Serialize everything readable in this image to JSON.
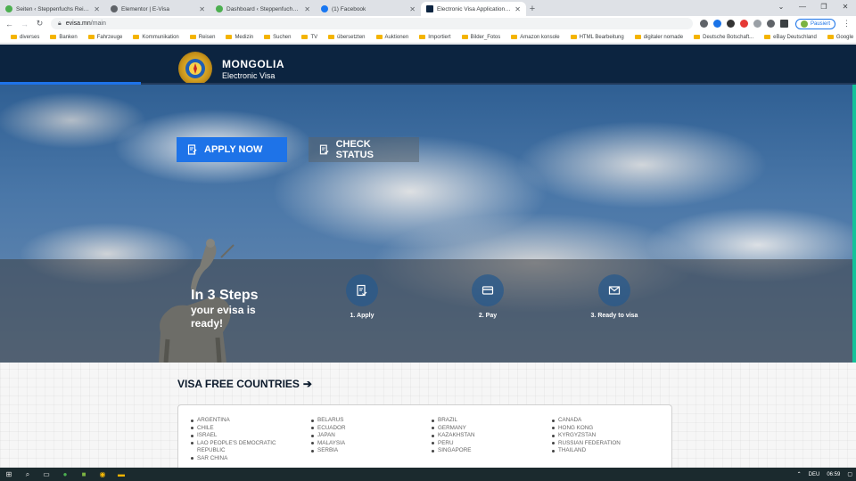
{
  "browser": {
    "tabs": [
      {
        "title": "Seiten ‹ Steppenfuchs Reisen —",
        "color": "#4caf50",
        "active": false
      },
      {
        "title": "Elementor | E-Visa",
        "color": "#5f6368",
        "active": false
      },
      {
        "title": "Dashboard ‹ Steppenfuchs Reise",
        "color": "#4caf50",
        "active": false
      },
      {
        "title": "(1) Facebook",
        "color": "#1877f2",
        "active": false
      },
      {
        "title": "Electronic Visa Application Syste",
        "color": "#0c2440",
        "active": true
      }
    ],
    "new_tab": "+",
    "url_host": "evisa.mn",
    "url_path": "/main",
    "profile_label": "Pausiert",
    "bookmarks": [
      "diverses",
      "Banken",
      "Fahrzeuge",
      "Kommunikation",
      "Reisen",
      "Medizin",
      "Suchen",
      "TV",
      "übersetzten",
      "Auktionen",
      "Importiert",
      "Bilder_Fotos",
      "Amazon konsole",
      "HTML Bearbeitung",
      "digitaler nomade",
      "Deutsche Botschaft...",
      "eBay Deutschland",
      "Google"
    ]
  },
  "site": {
    "brand_title": "MONGOLIA",
    "brand_subtitle": "Electronic Visa",
    "apply_label": "APPLY NOW",
    "check_label": "CHECK STATUS",
    "steps_title": "In 3 Steps",
    "steps_subtitle": "your evisa is ready!",
    "steps": [
      {
        "label": "1. Apply",
        "icon": "document-check-icon"
      },
      {
        "label": "2. Pay",
        "icon": "credit-card-icon"
      },
      {
        "label": "3. Ready to visa",
        "icon": "envelope-icon"
      }
    ],
    "visa_free_title": "VISA FREE COUNTRIES",
    "countries": [
      [
        "ARGENTINA",
        "CHILE",
        "ISRAEL",
        "LAO PEOPLE'S DEMOCRATIC REPUBLIC",
        "SAR CHINA"
      ],
      [
        "BELARUS",
        "ECUADOR",
        "JAPAN",
        "MALAYSIA",
        "SERBIA"
      ],
      [
        "BRAZIL",
        "GERMANY",
        "KAZAKHSTAN",
        "PERU",
        "SINGAPORE"
      ],
      [
        "CANADA",
        "HONG KONG",
        "KYRGYZSTAN",
        "RUSSIAN FEDERATION",
        "THAILAND"
      ]
    ]
  },
  "taskbar": {
    "language": "DEU",
    "time": "06:59"
  },
  "colors": {
    "header_bg": "#0c2440",
    "apply_button": "#1e73e8",
    "accent_green": "#14c29a"
  }
}
